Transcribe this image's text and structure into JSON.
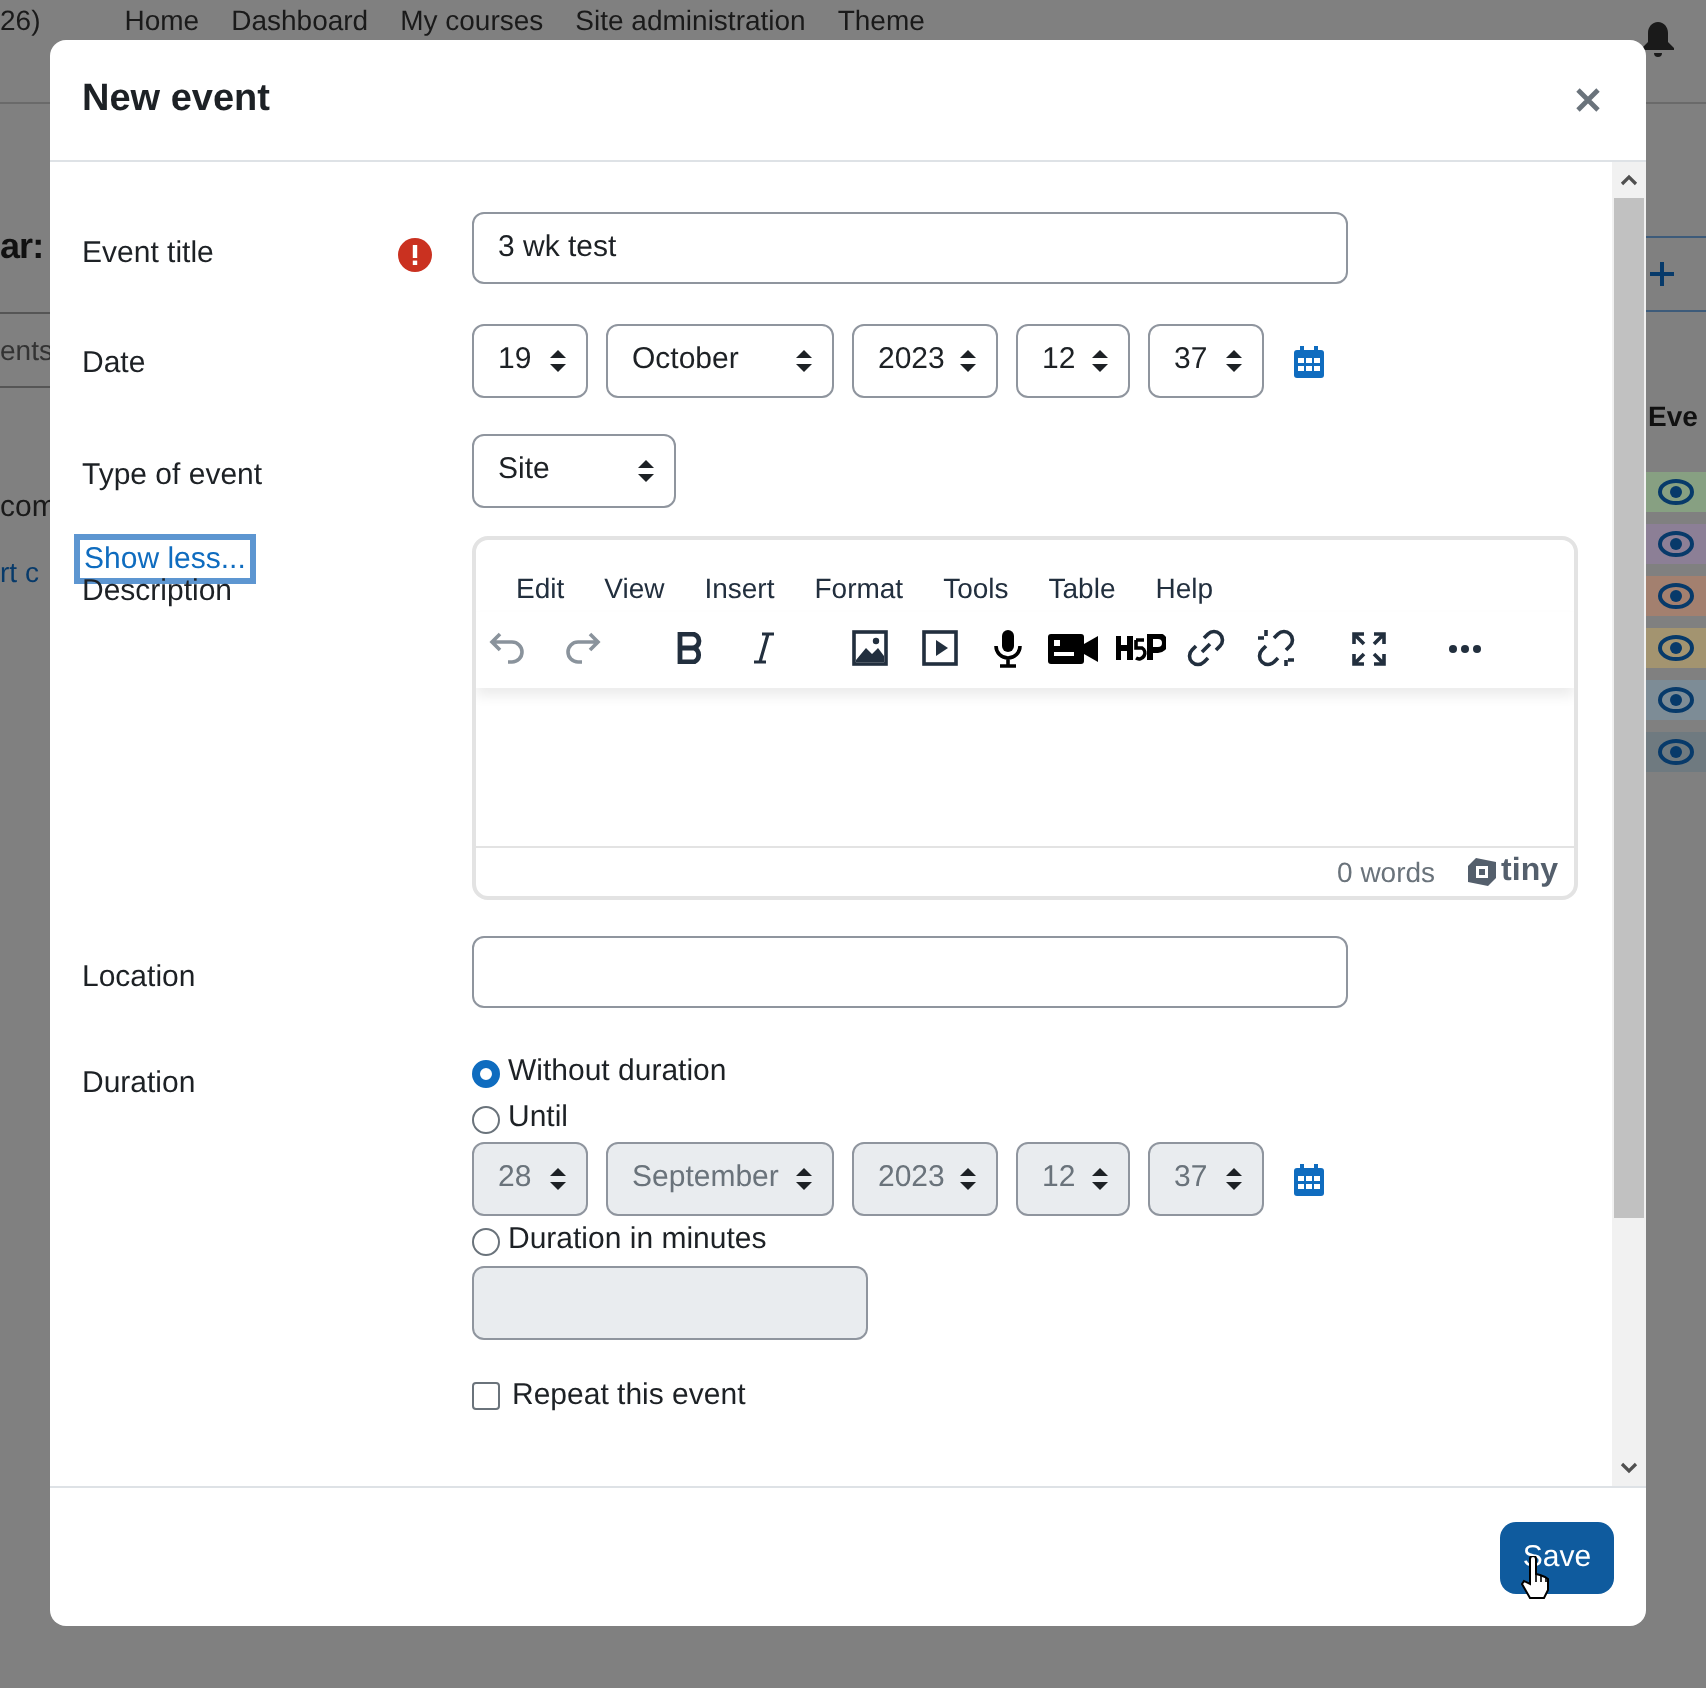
{
  "background_page": {
    "site_fragment": "26)",
    "nav_links": [
      "Home",
      "Dashboard",
      "My courses",
      "Site administration",
      "Theme"
    ],
    "heading_fragment": "ar:",
    "tab_fragment": "ents",
    "text_fragment": "com",
    "link_fragment": "rt c",
    "side_heading_fragment": "Eve",
    "event_types": [
      {
        "color": "#87a082"
      },
      {
        "color": "#8c7f96"
      },
      {
        "color": "#a3806f"
      },
      {
        "color": "#a39470"
      },
      {
        "color": "#7d8c96"
      },
      {
        "color": "#6f7a80"
      }
    ]
  },
  "dialog": {
    "title": "New event",
    "fields": [
      {
        "kind": "text",
        "label": "Event title",
        "required": true,
        "value": "3 wk test"
      },
      {
        "kind": "datetime",
        "label": "Date",
        "selects": [
          "19",
          "October",
          "2023",
          "12",
          "37"
        ]
      },
      {
        "kind": "select",
        "label": "Type of event",
        "value": "Site"
      },
      {
        "kind": "link",
        "label": "Show less...",
        "focused": true
      },
      {
        "kind": "editor",
        "label": "Description",
        "menu": [
          "Edit",
          "View",
          "Insert",
          "Format",
          "Tools",
          "Table",
          "Help"
        ],
        "word_count": "0 words",
        "brand": "tiny"
      },
      {
        "kind": "text",
        "label": "Location"
      },
      {
        "kind": "duration",
        "label": "Duration",
        "options": [
          {
            "label": "Without duration",
            "selected": true
          },
          {
            "label": "Until",
            "selected": false
          },
          {
            "label": "Duration in minutes",
            "selected": false
          }
        ],
        "until_selects": [
          "28",
          "September",
          "2023",
          "12",
          "37"
        ],
        "until_disabled": true,
        "minutes_disabled": true
      },
      {
        "kind": "checkbox",
        "label": "Repeat this event",
        "checked": false
      }
    ],
    "save_button": "Save"
  }
}
